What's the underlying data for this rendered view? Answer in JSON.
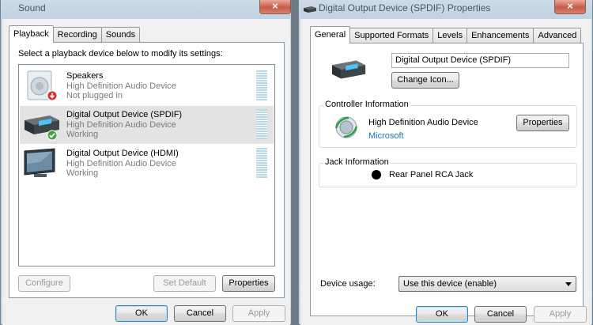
{
  "sound_dialog": {
    "title": "Sound",
    "close_glyph": "×",
    "tabs": [
      {
        "label": "Playback",
        "active": true
      },
      {
        "label": "Recording",
        "active": false
      },
      {
        "label": "Sounds",
        "active": false
      }
    ],
    "instruction": "Select a playback device below to modify its settings:",
    "devices": [
      {
        "name": "Speakers",
        "driver": "High Definition Audio Device",
        "status": "Not plugged in",
        "icon": "speaker-icon",
        "status_icon": "not-plugged-in-badge",
        "selected": false
      },
      {
        "name": "Digital Output Device (SPDIF)",
        "driver": "High Definition Audio Device",
        "status": "Working",
        "icon": "digital-output-device-icon",
        "status_icon": "default-device-check-badge",
        "selected": true
      },
      {
        "name": "Digital Output Device (HDMI)",
        "driver": "High Definition Audio Device",
        "status": "Working",
        "icon": "hdmi-monitor-icon",
        "status_icon": "",
        "selected": false
      }
    ],
    "buttons": {
      "configure": "Configure",
      "set_default": "Set Default",
      "properties": "Properties",
      "ok": "OK",
      "cancel": "Cancel",
      "apply": "Apply"
    }
  },
  "properties_dialog": {
    "title": "Digital Output Device (SPDIF) Properties",
    "close_glyph": "×",
    "tabs": [
      {
        "label": "General",
        "active": true
      },
      {
        "label": "Supported Formats",
        "active": false
      },
      {
        "label": "Levels",
        "active": false
      },
      {
        "label": "Enhancements",
        "active": false
      },
      {
        "label": "Advanced",
        "active": false
      }
    ],
    "device_name_value": "Digital Output Device (SPDIF)",
    "change_icon_label": "Change Icon...",
    "controller": {
      "heading": "Controller Information",
      "name": "High Definition Audio Device",
      "vendor": "Microsoft",
      "properties_label": "Properties"
    },
    "jack": {
      "heading": "Jack Information",
      "name": "Rear Panel RCA Jack"
    },
    "device_usage": {
      "label": "Device usage:",
      "selected": "Use this device (enable)"
    },
    "buttons": {
      "ok": "OK",
      "cancel": "Cancel",
      "apply": "Apply"
    },
    "colors": {
      "link": "#1e6fb8"
    }
  }
}
